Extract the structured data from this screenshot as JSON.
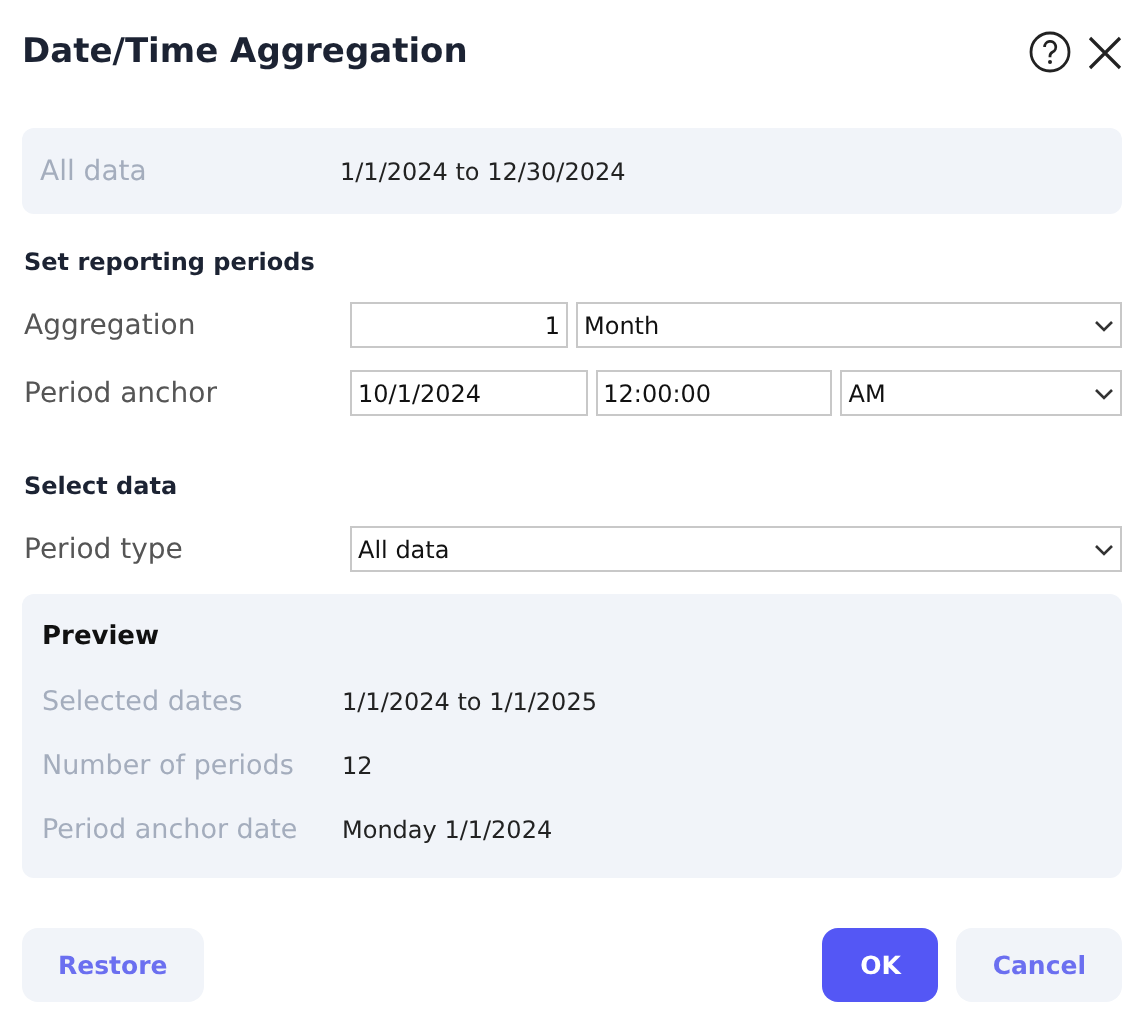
{
  "dialog": {
    "title": "Date/Time Aggregation"
  },
  "summary": {
    "label": "All data",
    "value": "1/1/2024 to 12/30/2024"
  },
  "sections": [
    {
      "heading": "Set reporting periods",
      "rows": [
        {
          "label": "Aggregation",
          "fields": [
            {
              "kind": "number",
              "value": "1"
            },
            {
              "kind": "select",
              "value": "Month"
            }
          ]
        },
        {
          "label": "Period anchor",
          "fields": [
            {
              "kind": "text",
              "value": "10/1/2024"
            },
            {
              "kind": "text",
              "value": "12:00:00"
            },
            {
              "kind": "select",
              "value": "AM"
            }
          ]
        }
      ]
    },
    {
      "heading": "Select data",
      "rows": [
        {
          "label": "Period type",
          "fields": [
            {
              "kind": "select",
              "value": "All data"
            }
          ]
        }
      ]
    }
  ],
  "preview": {
    "title": "Preview",
    "rows": [
      {
        "label": "Selected dates",
        "value": "1/1/2024 to 1/1/2025"
      },
      {
        "label": "Number of periods",
        "value": "12"
      },
      {
        "label": "Period anchor date",
        "value": "Monday 1/1/2024"
      }
    ]
  },
  "footer": {
    "left_buttons": [
      {
        "label": "Restore",
        "kind": "secondary"
      }
    ],
    "right_buttons": [
      {
        "label": "OK",
        "kind": "primary"
      },
      {
        "label": "Cancel",
        "kind": "secondary"
      }
    ]
  }
}
